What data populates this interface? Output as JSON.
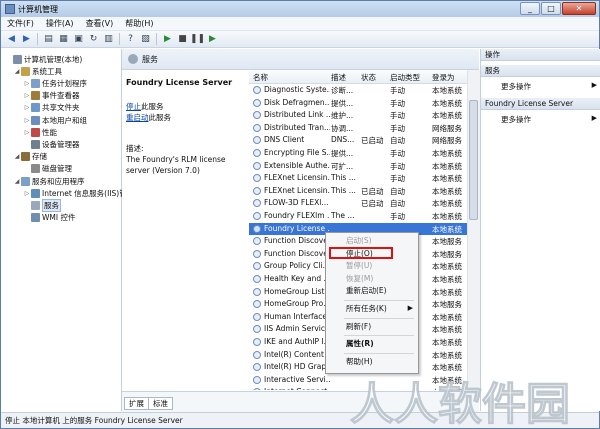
{
  "window": {
    "title": "计算机管理"
  },
  "menubar": [
    "文件(F)",
    "操作(A)",
    "查看(V)",
    "帮助(H)"
  ],
  "tree": {
    "items": [
      {
        "label": "计算机管理(本地)",
        "level": 0,
        "expander": ""
      },
      {
        "label": "系统工具",
        "level": 1,
        "expander": "◢"
      },
      {
        "label": "任务计划程序",
        "level": 2,
        "expander": "▷"
      },
      {
        "label": "事件查看器",
        "level": 2,
        "expander": "▷"
      },
      {
        "label": "共享文件夹",
        "level": 2,
        "expander": "▷"
      },
      {
        "label": "本地用户和组",
        "level": 2,
        "expander": "▷"
      },
      {
        "label": "性能",
        "level": 2,
        "expander": "▷"
      },
      {
        "label": "设备管理器",
        "level": 2,
        "expander": ""
      },
      {
        "label": "存储",
        "level": 1,
        "expander": "◢"
      },
      {
        "label": "磁盘管理",
        "level": 2,
        "expander": ""
      },
      {
        "label": "服务和应用程序",
        "level": 1,
        "expander": "◢"
      },
      {
        "label": "Internet 信息服务(IIS)管",
        "level": 2,
        "expander": "▷"
      },
      {
        "label": "服务",
        "level": 2,
        "expander": "",
        "selected": true
      },
      {
        "label": "WMI 控件",
        "level": 2,
        "expander": ""
      }
    ]
  },
  "center": {
    "header": "服务",
    "detail": {
      "title": "Foundry License Server",
      "stop_link": "停止",
      "stop_suffix": "此服务",
      "restart_link": "重启动",
      "restart_suffix": "此服务",
      "desc_label": "描述:",
      "desc_text": "The Foundry's RLM license server (Version 7.0)"
    },
    "columns": [
      "名称",
      "描述",
      "状态",
      "启动类型",
      "登录为"
    ],
    "rows": [
      {
        "name": "Diagnostic Syste...",
        "desc": "诊断...",
        "status": "",
        "start": "手动",
        "logon": "本地系统"
      },
      {
        "name": "Disk Defragmen...",
        "desc": "提供...",
        "status": "",
        "start": "手动",
        "logon": "本地系统"
      },
      {
        "name": "Distributed Link ...",
        "desc": "维护...",
        "status": "",
        "start": "手动",
        "logon": "本地系统"
      },
      {
        "name": "Distributed Tran...",
        "desc": "协调...",
        "status": "",
        "start": "手动",
        "logon": "网络服务"
      },
      {
        "name": "DNS Client",
        "desc": "DNS...",
        "status": "已启动",
        "start": "自动",
        "logon": "网络服务"
      },
      {
        "name": "Encrypting File S...",
        "desc": "提供...",
        "status": "",
        "start": "手动",
        "logon": "本地系统"
      },
      {
        "name": "Extensible Authe...",
        "desc": "可扩...",
        "status": "",
        "start": "手动",
        "logon": "本地系统"
      },
      {
        "name": "FLEXnet Licensin...",
        "desc": "This ...",
        "status": "",
        "start": "手动",
        "logon": "本地系统"
      },
      {
        "name": "FLEXnet Licensin...",
        "desc": "This ...",
        "status": "已启动",
        "start": "自动",
        "logon": "本地系统"
      },
      {
        "name": "FLOW-3D FLEXl...",
        "desc": "",
        "status": "已启动",
        "start": "自动",
        "logon": "本地系统"
      },
      {
        "name": "Foundry FLEXlm ...",
        "desc": "The ...",
        "status": "",
        "start": "手动",
        "logon": "本地系统"
      },
      {
        "name": "Foundry License ...",
        "desc": "",
        "status": "",
        "start": "",
        "logon": "本地系统",
        "selected": true
      },
      {
        "name": "Function Discove...",
        "desc": "",
        "status": "",
        "start": "",
        "logon": "本地服务"
      },
      {
        "name": "Function Discove...",
        "desc": "",
        "status": "",
        "start": "",
        "logon": "本地服务"
      },
      {
        "name": "Group Policy Cli...",
        "desc": "",
        "status": "",
        "start": "",
        "logon": "本地系统"
      },
      {
        "name": "Health Key and ...",
        "desc": "",
        "status": "",
        "start": "",
        "logon": "本地系统"
      },
      {
        "name": "HomeGroup List...",
        "desc": "",
        "status": "",
        "start": "",
        "logon": "本地系统"
      },
      {
        "name": "HomeGroup Pro...",
        "desc": "",
        "status": "",
        "start": "",
        "logon": "本地服务"
      },
      {
        "name": "Human Interface...",
        "desc": "",
        "status": "",
        "start": "",
        "logon": "本地系统"
      },
      {
        "name": "IIS Admin Service",
        "desc": "",
        "status": "",
        "start": "",
        "logon": "本地系统"
      },
      {
        "name": "IKE and AuthIP I...",
        "desc": "",
        "status": "",
        "start": "",
        "logon": "本地系统"
      },
      {
        "name": "Intel(R) Content ...",
        "desc": "",
        "status": "",
        "start": "",
        "logon": "本地系统"
      },
      {
        "name": "Intel(R) HD Grap...",
        "desc": "",
        "status": "",
        "start": "",
        "logon": "本地系统"
      },
      {
        "name": "Interactive Servi...",
        "desc": "",
        "status": "",
        "start": "",
        "logon": "本地系统"
      },
      {
        "name": "Internet Connect...",
        "desc": "",
        "status": "",
        "start": "",
        "logon": "本地系统"
      }
    ],
    "tabs": [
      "扩展",
      "标准"
    ]
  },
  "context_menu": {
    "items": [
      {
        "label": "启动(S)",
        "disabled": true
      },
      {
        "label": "停止(O)",
        "highlighted": true
      },
      {
        "label": "暂停(U)",
        "disabled": true
      },
      {
        "label": "恢复(M)",
        "disabled": true
      },
      {
        "label": "重新启动(E)"
      },
      {
        "sep": true
      },
      {
        "label": "所有任务(K)",
        "submenu": true
      },
      {
        "sep": true
      },
      {
        "label": "刷新(F)"
      },
      {
        "sep": true
      },
      {
        "label": "属性(R)",
        "bold": true
      },
      {
        "sep": true
      },
      {
        "label": "帮助(H)"
      }
    ]
  },
  "actions": {
    "header": "操作",
    "section1": "服务",
    "more1": "更多操作",
    "section2": "Foundry License Server",
    "more2": "更多操作"
  },
  "status": "停止 本地计算机 上的服务 Foundry License Server",
  "watermark": "人人软件园",
  "colors": {
    "selection": "#3875d7",
    "highlight_border": "#e10f0f",
    "link": "#0645ad"
  }
}
